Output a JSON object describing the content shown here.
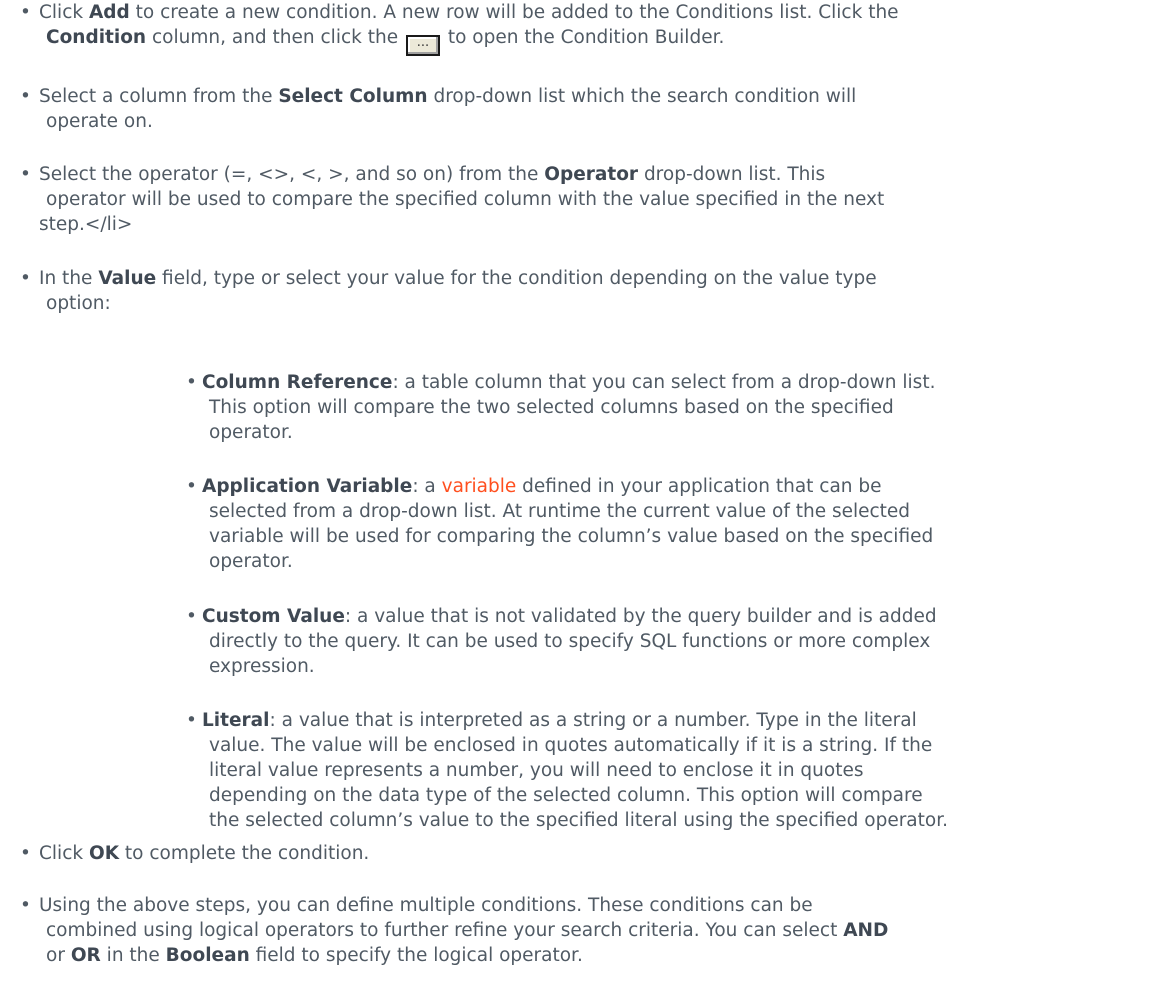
{
  "items": [
    {
      "t1": "Click ",
      "b1": "Add",
      "t2": " to create a new condition. A new row will be added to the Conditions list. Click the",
      "b2": "Condition",
      "t3": " column, and then click the ",
      "button_glyph": "...",
      "t4": " to open the Condition Builder."
    },
    {
      "t1": "Select a column from the ",
      "b1": "Select Column",
      "t2": " drop-down list which the search condition will",
      "t3": "operate on."
    },
    {
      "t1": "Select the operator (=, <>, <, >, and so on) from the ",
      "b1": "Operator",
      "t2": " drop-down list. This",
      "t3": "operator will be used to compare the specified column with the value specified in the next",
      "t4": "step.</li>"
    },
    {
      "t1": "In the ",
      "b1": "Value",
      "t2": " field, type or select your value for the condition depending on the value type",
      "t3": "option:"
    },
    {
      "t1": "Click ",
      "b1": "OK",
      "t2": " to complete the condition."
    },
    {
      "t1": "Using the above steps, you can define multiple conditions. These conditions can be",
      "t2": "combined using logical operators to further refine your search criteria. You can select ",
      "b1": "AND",
      "t3": "or ",
      "b2": "OR",
      "t4": " in the ",
      "b3": "Boolean",
      "t5": " field to specify the logical operator."
    }
  ],
  "sub_items": [
    {
      "term": "Column Reference",
      "l1": ":  a table column that you can select from a drop-down list.",
      "l2": "This option will compare the two selected columns based on the specified",
      "l3": "operator."
    },
    {
      "term": "Application Variable",
      "l1a": ":  a ",
      "link": "variable",
      "l1b": " defined in your application that can be",
      "l2": "selected from a drop-down list. At runtime the current value of the selected",
      "l3": "variable will be used for comparing the column’s value based on the specified",
      "l4": "operator."
    },
    {
      "term": "Custom Value",
      "l1": ":  a value that is not validated by the query builder and is added",
      "l2": "directly to the query.  It can be used to specify SQL functions or more complex",
      "l3": "expression."
    },
    {
      "term": "Literal",
      "l1": ":  a value that is interpreted as a string or a number. Type in the literal",
      "l2": "value. The value will be enclosed in quotes automatically if it is a string. If the",
      "l3": "literal value represents a number, you will need to enclose it in quotes",
      "l4": "depending on the data type of the selected column. This option will compare",
      "l5": "the selected column’s value to the specified literal using the specified operator."
    }
  ],
  "colors": {
    "text": "#505a64",
    "bold": "#3f4853",
    "link": "#ff4f1f"
  }
}
